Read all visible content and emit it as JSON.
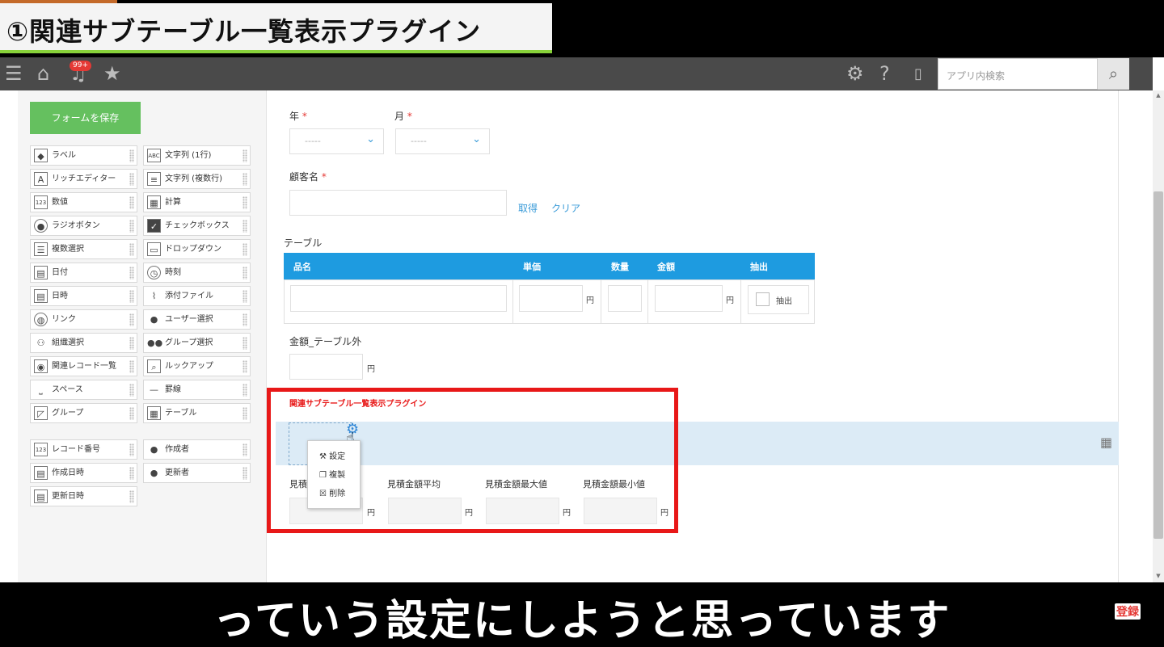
{
  "video": {
    "title": "①関連サブテーブル一覧表示プラグイン",
    "subtitle": "っていう設定にしようと思っています",
    "register_badge": "登録"
  },
  "topbar": {
    "notification_count": "99+",
    "search_placeholder": "アプリ内検索"
  },
  "palette": {
    "save_button": "フォームを保存",
    "items": [
      {
        "label": "ラベル",
        "icon": "tag-icon"
      },
      {
        "label": "文字列 (1行)",
        "icon": "abc-icon"
      },
      {
        "label": "リッチエディター",
        "icon": "rich-editor-icon"
      },
      {
        "label": "文字列 (複数行)",
        "icon": "multiline-icon"
      },
      {
        "label": "数値",
        "icon": "number-icon"
      },
      {
        "label": "計算",
        "icon": "calculator-icon"
      },
      {
        "label": "ラジオボタン",
        "icon": "radio-icon"
      },
      {
        "label": "チェックボックス",
        "icon": "checkbox-icon"
      },
      {
        "label": "複数選択",
        "icon": "multi-select-icon"
      },
      {
        "label": "ドロップダウン",
        "icon": "dropdown-icon"
      },
      {
        "label": "日付",
        "icon": "calendar-icon"
      },
      {
        "label": "時刻",
        "icon": "clock-icon"
      },
      {
        "label": "日時",
        "icon": "calendar-icon"
      },
      {
        "label": "添付ファイル",
        "icon": "paperclip-icon"
      },
      {
        "label": "リンク",
        "icon": "globe-icon"
      },
      {
        "label": "ユーザー選択",
        "icon": "user-icon"
      },
      {
        "label": "組織選択",
        "icon": "org-icon"
      },
      {
        "label": "グループ選択",
        "icon": "group-icon"
      },
      {
        "label": "関連レコード一覧",
        "icon": "related-records-icon"
      },
      {
        "label": "ルックアップ",
        "icon": "lookup-icon"
      },
      {
        "label": "スペース",
        "icon": "space-icon"
      },
      {
        "label": "罫線",
        "icon": "line-icon"
      },
      {
        "label": "グループ",
        "icon": "group-box-icon"
      },
      {
        "label": "テーブル",
        "icon": "table-icon"
      }
    ],
    "system_items": [
      {
        "label": "レコード番号",
        "icon": "number-icon"
      },
      {
        "label": "作成者",
        "icon": "user-icon"
      },
      {
        "label": "作成日時",
        "icon": "calendar-icon"
      },
      {
        "label": "更新者",
        "icon": "user-icon"
      },
      {
        "label": "更新日時",
        "icon": "calendar-icon"
      }
    ]
  },
  "form": {
    "year_label": "年",
    "month_label": "月",
    "required_mark": "*",
    "select_placeholder": "-----",
    "customer_label": "顧客名",
    "fetch_link": "取得",
    "clear_link": "クリア",
    "table_label": "テーブル",
    "table_columns": [
      "品名",
      "単価",
      "数量",
      "金額",
      "抽出"
    ],
    "yen": "円",
    "extract_checkbox": "抽出",
    "amount_outside_label": "金額_テーブル外",
    "plugin_title": "関連サブテーブル一覧表示プラグイン",
    "context_menu": [
      "設定",
      "複製",
      "削除"
    ],
    "stats": [
      "見積",
      "見積金額平均",
      "見積金額最大値",
      "見積金額最小値"
    ]
  }
}
